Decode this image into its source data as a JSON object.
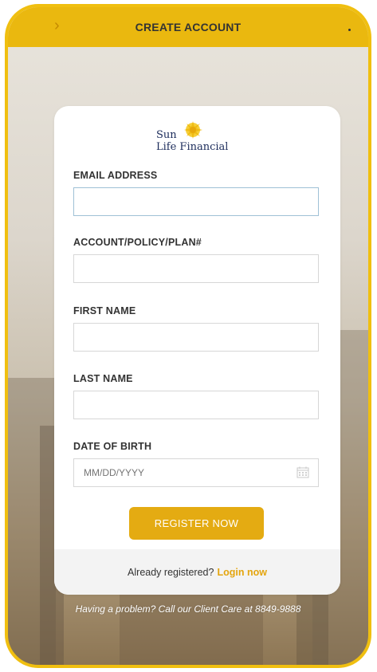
{
  "header": {
    "title": "CREATE ACCOUNT",
    "back_icon": "chevron-right-icon"
  },
  "brand": {
    "line1": "Sun",
    "line2": "Life Financial",
    "accent_color": "#eab80f",
    "text_color": "#1c2c5b"
  },
  "form": {
    "email": {
      "label": "EMAIL ADDRESS",
      "value": "",
      "placeholder": ""
    },
    "account": {
      "label": "ACCOUNT/POLICY/PLAN#",
      "value": "",
      "placeholder": ""
    },
    "first_name": {
      "label": "FIRST NAME",
      "value": "",
      "placeholder": ""
    },
    "last_name": {
      "label": "LAST NAME",
      "value": "",
      "placeholder": ""
    },
    "dob": {
      "label": "DATE OF BIRTH",
      "value": "",
      "placeholder": "MM/DD/YYYY",
      "icon": "calendar-icon"
    }
  },
  "actions": {
    "register_label": "REGISTER NOW"
  },
  "footer": {
    "prompt": "Already registered?",
    "login_label": "Login now"
  },
  "help_text": "Having a problem? Call our Client Care at 8849-9888"
}
